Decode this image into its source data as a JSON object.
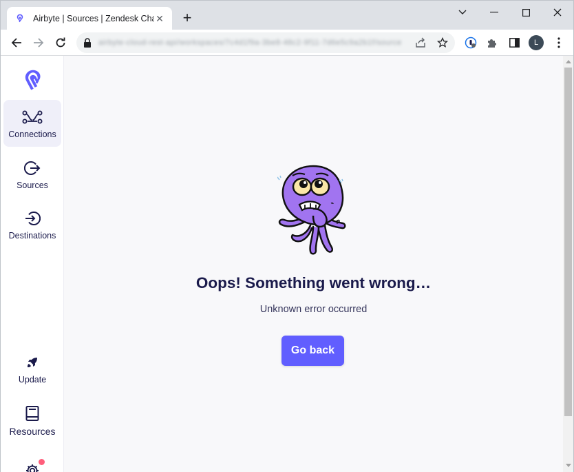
{
  "browser": {
    "tab_title": "Airbyte | Sources | Zendesk Chat",
    "tab_close": "✕",
    "new_tab": "+",
    "url_blurred": "airbyte-cloud-rest-api/workspaces/7c4d1f9a-3be8-48c2-9f11-7d6e5c9a2b1f/source",
    "profile_initial": "L"
  },
  "sidebar": {
    "items": [
      {
        "label": "Connections",
        "icon": "connections-icon"
      },
      {
        "label": "Sources",
        "icon": "sources-icon"
      },
      {
        "label": "Destinations",
        "icon": "destinations-icon"
      },
      {
        "label": "Update",
        "icon": "rocket-icon"
      },
      {
        "label": "Resources",
        "icon": "book-icon"
      },
      {
        "label": "",
        "icon": "gear-icon"
      }
    ]
  },
  "error": {
    "title": "Oops! Something went wrong…",
    "message": "Unknown error occurred",
    "button": "Go back"
  },
  "colors": {
    "accent": "#615eff",
    "text_dark": "#1a1a4b",
    "active_nav_bg": "#efeff9",
    "octopus": "#a174f0",
    "badge": "#ff5e7b"
  }
}
